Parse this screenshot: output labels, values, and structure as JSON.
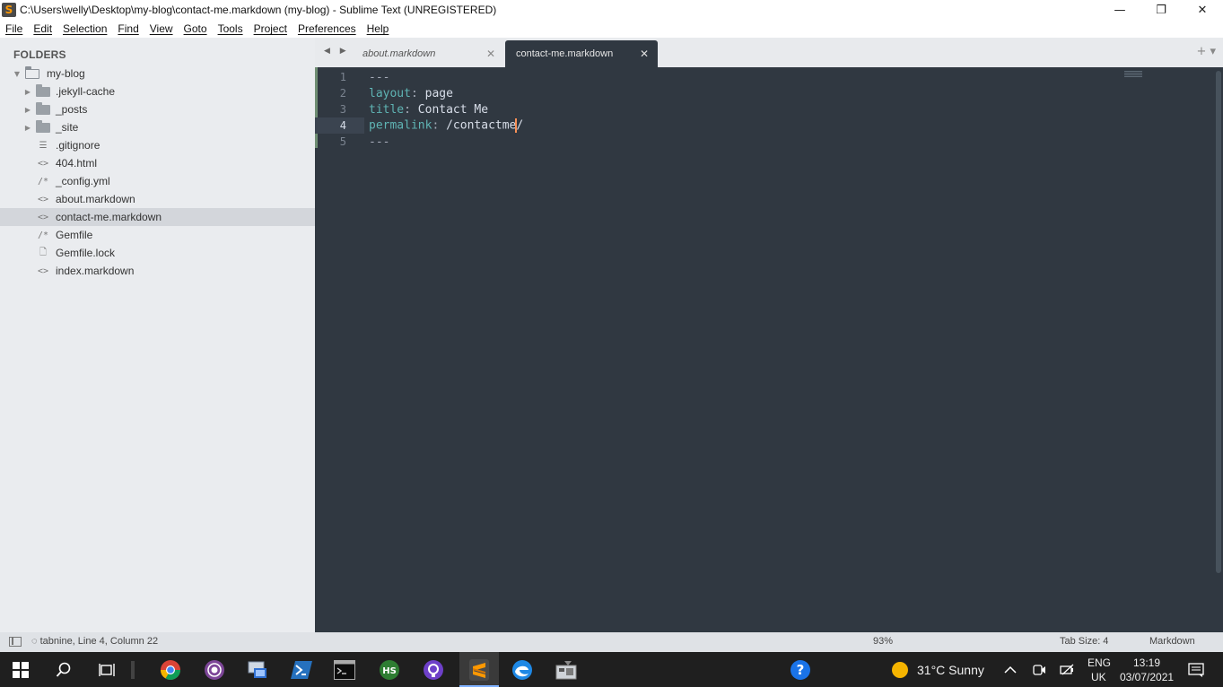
{
  "window": {
    "title": "C:\\Users\\welly\\Desktop\\my-blog\\contact-me.markdown (my-blog) - Sublime Text (UNREGISTERED)",
    "app_icon_glyph": "S",
    "minimize_glyph": "—",
    "maximize_glyph": "❐",
    "close_glyph": "✕"
  },
  "menu": [
    "File",
    "Edit",
    "Selection",
    "Find",
    "View",
    "Goto",
    "Tools",
    "Project",
    "Preferences",
    "Help"
  ],
  "sidebar": {
    "header": "FOLDERS",
    "root": "my-blog",
    "items": [
      {
        "name": ".jekyll-cache",
        "type": "folder",
        "icon": "folder-icon"
      },
      {
        "name": "_posts",
        "type": "folder",
        "icon": "folder-icon"
      },
      {
        "name": "_site",
        "type": "folder",
        "icon": "folder-icon"
      },
      {
        "name": ".gitignore",
        "type": "file",
        "icon": "text-lines-icon",
        "glyph": "☰"
      },
      {
        "name": "404.html",
        "type": "file",
        "icon": "code-file-icon",
        "glyph": "<>"
      },
      {
        "name": "_config.yml",
        "type": "file",
        "icon": "comment-file-icon",
        "glyph": "/*"
      },
      {
        "name": "about.markdown",
        "type": "file",
        "icon": "code-file-icon",
        "glyph": "<>"
      },
      {
        "name": "contact-me.markdown",
        "type": "file",
        "icon": "code-file-icon",
        "glyph": "<>",
        "selected": true
      },
      {
        "name": "Gemfile",
        "type": "file",
        "icon": "comment-file-icon",
        "glyph": "/*"
      },
      {
        "name": "Gemfile.lock",
        "type": "file",
        "icon": "plain-file-icon",
        "glyph": "🗋"
      },
      {
        "name": "index.markdown",
        "type": "file",
        "icon": "code-file-icon",
        "glyph": "<>"
      }
    ]
  },
  "tabs": {
    "nav": "◀ ▶",
    "items": [
      {
        "label": "about.markdown",
        "active": false
      },
      {
        "label": "contact-me.markdown",
        "active": true
      }
    ],
    "close_glyph": "✕",
    "right_controls": "+ ▾"
  },
  "editor": {
    "lines": [
      {
        "num": "1",
        "key": "",
        "sep": "",
        "value": "---"
      },
      {
        "num": "2",
        "key": "layout",
        "sep": ": ",
        "value": "page"
      },
      {
        "num": "3",
        "key": "title",
        "sep": ": ",
        "value": "Contact Me"
      },
      {
        "num": "4",
        "key": "permalink",
        "sep": ": ",
        "value_before_caret": "/contactme",
        "value_after_caret": "/",
        "current": true
      },
      {
        "num": "5",
        "key": "",
        "sep": "",
        "value": "---"
      }
    ],
    "colors": {
      "background": "#303841",
      "key": "#5fb4b4",
      "value": "#d8dee9",
      "caret": "#f99157"
    }
  },
  "statusbar": {
    "left": "◌ tabnine, Line 4, Column 22",
    "zoom": "93%",
    "tab_size": "Tab Size: 4",
    "syntax": "Markdown"
  },
  "taskbar": {
    "weather": "31°C  Sunny",
    "lang_top": "ENG",
    "lang_bottom": "UK",
    "time": "13:19",
    "date": "03/07/2021",
    "apps": [
      "windows-start-icon",
      "search-icon",
      "task-view-icon",
      "chrome-icon",
      "tor-icon",
      "remote-desktop-icon",
      "powershell-icon",
      "terminal-icon",
      "hs-icon",
      "github-icon",
      "sublime-icon",
      "edge-icon",
      "unknown-app-icon",
      "help-icon"
    ]
  }
}
